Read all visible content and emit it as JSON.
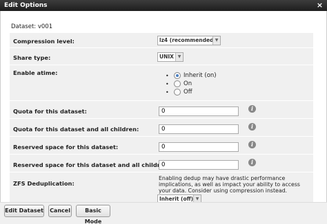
{
  "window": {
    "title": "Edit Options",
    "close_icon": "close-icon"
  },
  "dataset": {
    "label": "Dataset: v001"
  },
  "fields": {
    "compression": {
      "label": "Compression level:",
      "value": "lz4 (recommended)"
    },
    "share_type": {
      "label": "Share type:",
      "value": "UNIX"
    },
    "atime": {
      "label": "Enable atime:",
      "options": [
        {
          "label": "Inherit (on)",
          "checked": true
        },
        {
          "label": "On",
          "checked": false
        },
        {
          "label": "Off",
          "checked": false
        }
      ]
    },
    "quota": {
      "label": "Quota for this dataset:",
      "value": "0"
    },
    "quota_children": {
      "label": "Quota for this dataset and all children:",
      "value": "0"
    },
    "reserved": {
      "label": "Reserved space for this dataset:",
      "value": "0"
    },
    "reserved_children": {
      "label": "Reserved space for this dataset and all children:",
      "value": "0"
    },
    "dedup": {
      "label": "ZFS Deduplication:",
      "warning": "Enabling dedup may have drastic performance implications, as well as impact your ability to access your data. Consider using compression instead.",
      "value": "Inherit (off)"
    }
  },
  "buttons": {
    "edit": "Edit Dataset",
    "cancel": "Cancel",
    "basic": "Basic Mode"
  },
  "colors": {
    "titlebar": "#2b2b2b",
    "form_bg": "#f0f0f0",
    "radio_accent": "#4a7fc1"
  }
}
